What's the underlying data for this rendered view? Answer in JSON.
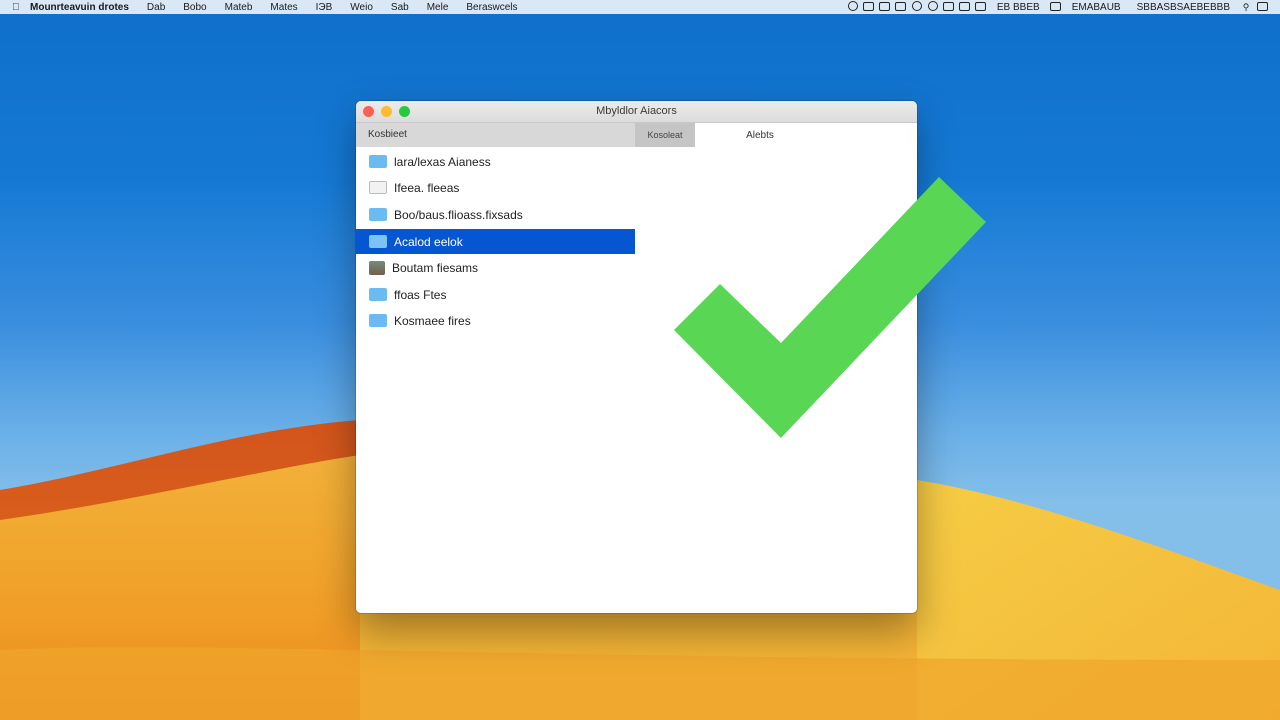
{
  "menubar": {
    "app_name": "Mounrteavuin drotes",
    "items": [
      "Dab",
      "Bobo",
      "Mateb",
      "Mates",
      "IЭB",
      "Weio",
      "Sab",
      "Mele",
      "Beraswcels"
    ],
    "status_text_1": "EB BBEB",
    "status_text_2": "EMABAUB",
    "status_text_3": "SBBASBSAEBEBBB"
  },
  "window": {
    "title": "Mbyldlor Aiacors",
    "sidebar_header": "Kosbieet",
    "tab_active": "Kosoleat",
    "tab_inactive": "Alebts"
  },
  "sidebar": {
    "items": [
      {
        "label": "lara/lexas Aianess",
        "icon": "folder-icon"
      },
      {
        "label": "Ifeea. fleeas",
        "icon": "document-icon"
      },
      {
        "label": "Boo/baus.flioass.fixsads",
        "icon": "folder-icon"
      },
      {
        "label": "Acalod eelok",
        "icon": "folder-icon"
      },
      {
        "label": "Boutam fiesams",
        "icon": "image-icon"
      },
      {
        "label": "ffoas Ftes",
        "icon": "folder-icon"
      },
      {
        "label": "Kosmaee fires",
        "icon": "folder-icon"
      }
    ],
    "selected_index": 3
  },
  "colors": {
    "selection": "#0756d1",
    "folder": "#6bbaf2",
    "check": "#58d654",
    "close": "#fd5f57",
    "minimize": "#fdbc2e",
    "zoom": "#28c840"
  }
}
